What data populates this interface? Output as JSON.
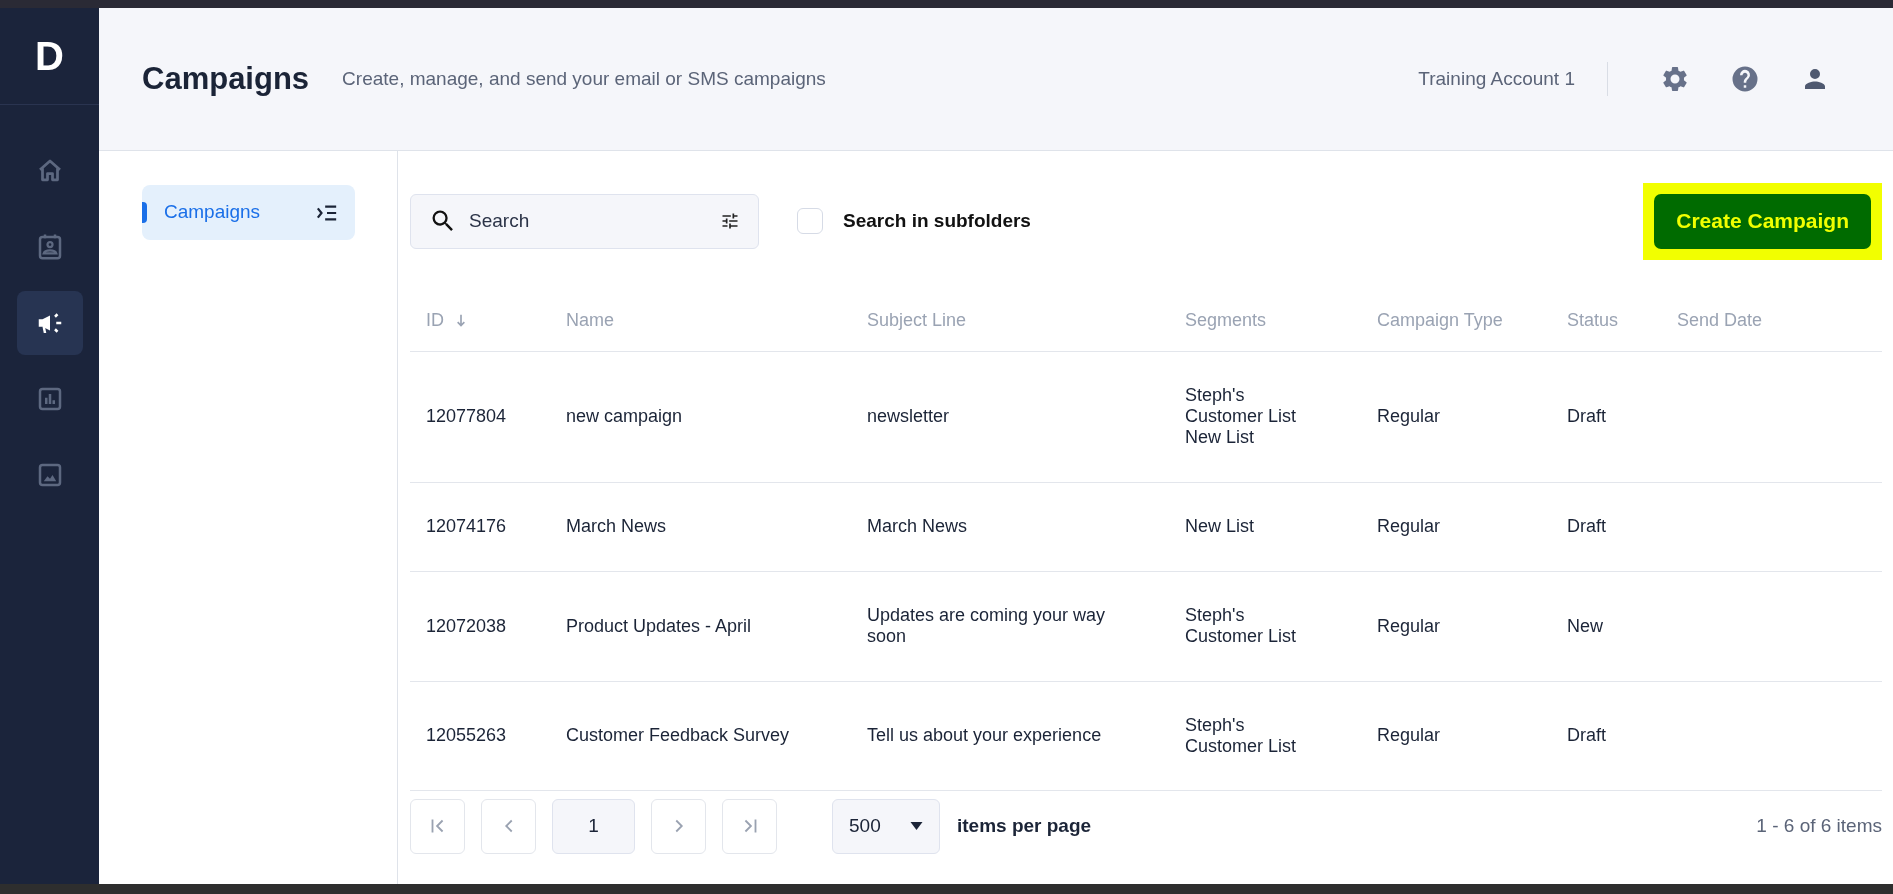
{
  "logo": "D",
  "nav": [
    {
      "kind": "home",
      "selected": false
    },
    {
      "kind": "contacts",
      "selected": false
    },
    {
      "kind": "campaigns",
      "selected": true
    },
    {
      "kind": "reports",
      "selected": false
    },
    {
      "kind": "images",
      "selected": false
    }
  ],
  "header": {
    "title": "Campaigns",
    "subtitle": "Create, manage, and send your email or SMS campaigns",
    "account": "Training Account 1"
  },
  "folders": [
    {
      "label": "Campaigns",
      "selected": true
    }
  ],
  "search": {
    "placeholder": "Search"
  },
  "subfolders": {
    "label": "Search in subfolders",
    "checked": false
  },
  "create_button": {
    "label": "Create Campaign",
    "highlighted": true
  },
  "table": {
    "columns": [
      {
        "label": "ID",
        "sorted": true
      },
      {
        "label": "Name",
        "sorted": false
      },
      {
        "label": "Subject Line",
        "sorted": false
      },
      {
        "label": "Segments",
        "sorted": false
      },
      {
        "label": "Campaign Type",
        "sorted": false
      },
      {
        "label": "Status",
        "sorted": false
      },
      {
        "label": "Send Date",
        "sorted": false
      }
    ],
    "rows": [
      {
        "id": "12077804",
        "name": "new campaign",
        "subject": "newsletter",
        "segments": [
          "Steph's Customer List",
          "New List"
        ],
        "type": "Regular",
        "status": "Draft"
      },
      {
        "id": "12074176",
        "name": "March News",
        "subject": "March News",
        "segments": [
          "New List"
        ],
        "type": "Regular",
        "status": "Draft"
      },
      {
        "id": "12072038",
        "name": "Product Updates - April",
        "subject": "Updates are coming your way soon",
        "segments": [
          "Steph's Customer List"
        ],
        "type": "Regular",
        "status": "New"
      },
      {
        "id": "12055263",
        "name": "Customer Feedback Survey",
        "subject": "Tell us about your experience",
        "segments": [
          "Steph's Customer List"
        ],
        "type": "Regular",
        "status": "Draft"
      }
    ]
  },
  "pagination": {
    "page": "1",
    "page_size": "500",
    "page_size_label": "items per page",
    "summary": "1 - 6 of 6 items"
  }
}
